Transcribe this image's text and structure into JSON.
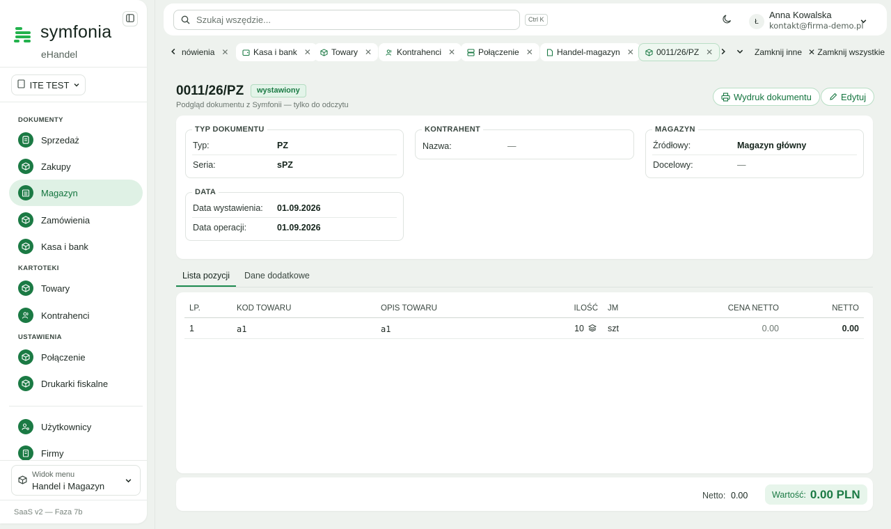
{
  "app": {
    "logo_name": "symfonia",
    "logo_sub": "eHandel",
    "company": "ITE TEST",
    "footer_version": "SaaS v2 — Faza 7b"
  },
  "sidebar": {
    "sections": {
      "documents": "DOKUMENTY",
      "records": "KARTOTEKI",
      "settings": "USTAWIENIA"
    },
    "items": [
      {
        "label": "Sprzedaż",
        "icon": "document-icon"
      },
      {
        "label": "Zakupy",
        "icon": "box-icon"
      },
      {
        "label": "Magazyn",
        "icon": "warehouse-icon",
        "active": true
      },
      {
        "label": "Zamówienia",
        "icon": "box-icon"
      },
      {
        "label": "Kasa i bank",
        "icon": "box-icon"
      },
      {
        "label": "Towary",
        "icon": "box-icon"
      },
      {
        "label": "Kontrahenci",
        "icon": "users-icon"
      },
      {
        "label": "Połączenie",
        "icon": "box-icon"
      },
      {
        "label": "Drukarki fiskalne",
        "icon": "box-icon"
      },
      {
        "label": "Użytkownicy",
        "icon": "user-key-icon"
      },
      {
        "label": "Firmy",
        "icon": "building-icon"
      }
    ],
    "menu_view": {
      "label": "Widok menu",
      "value": "Handel i Magazyn"
    }
  },
  "topbar": {
    "search_placeholder": "Szukaj wszędzie...",
    "shortcut": "Ctrl K",
    "user_initial": "Ł",
    "user_name": "Anna Kowalska",
    "user_email": "kontakt@firma-demo.pl"
  },
  "tabs": [
    {
      "label": "nówienia",
      "icon": ""
    },
    {
      "label": "Kasa i bank",
      "icon": "wallet-icon"
    },
    {
      "label": "Towary",
      "icon": "box-icon"
    },
    {
      "label": "Kontrahenci",
      "icon": "users-icon"
    },
    {
      "label": "Połączenie",
      "icon": "server-icon"
    },
    {
      "label": "Handel-magazyn",
      "icon": "file-icon"
    },
    {
      "label": "0011/26/PZ",
      "icon": "box-icon",
      "active": true
    }
  ],
  "tab_actions": {
    "close_others": "Zamknij inne",
    "close_all": "Zamknij wszystkie"
  },
  "document": {
    "number": "0011/26/PZ",
    "status": "wystawiony",
    "subtitle": "Podgląd dokumentu z Symfonii — tylko do odczytu",
    "print_button": "Wydruk dokumentu",
    "edit_button": "Edytuj",
    "type_section": {
      "title": "TYP DOKUMENTU",
      "type_label": "Typ:",
      "type_value": "PZ",
      "series_label": "Seria:",
      "series_value": "sPZ"
    },
    "contractor_section": {
      "title": "KONTRAHENT",
      "name_label": "Nazwa:",
      "name_value": "—"
    },
    "warehouse_section": {
      "title": "MAGAZYN",
      "source_label": "Źródłowy:",
      "source_value": "Magazyn główny",
      "target_label": "Docelowy:",
      "target_value": "—"
    },
    "date_section": {
      "title": "DATA",
      "issue_label": "Data wystawienia:",
      "issue_value": "01.09.2026",
      "operation_label": "Data operacji:",
      "operation_value": "01.09.2026"
    }
  },
  "subtabs": {
    "positions": "Lista pozycji",
    "additional": "Dane dodatkowe"
  },
  "table": {
    "columns": [
      "LP.",
      "KOD TOWARU",
      "OPIS TOWARU",
      "ILOŚĆ",
      "JM",
      "CENA NETTO",
      "NETTO"
    ],
    "rows": [
      {
        "lp": "1",
        "code": "a1",
        "desc": "a1",
        "qty": "10",
        "unit": "szt",
        "price": "0.00",
        "net": "0.00"
      }
    ]
  },
  "summary": {
    "net_label": "Netto:",
    "net_value": "0.00",
    "total_label": "Wartość:",
    "total_value": "0.00 PLN"
  },
  "colors": {
    "accent": "#1b7a44",
    "active_bg": "#dff1e5",
    "badge_bg": "#e3f4e9"
  }
}
